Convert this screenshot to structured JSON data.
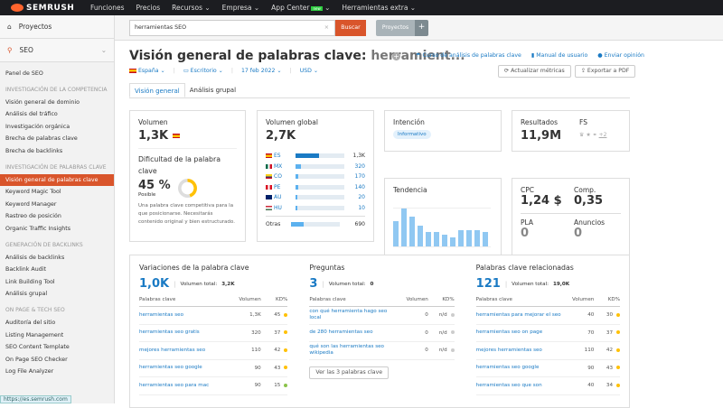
{
  "topbar": {
    "logo": "SEMRUSH",
    "nav": [
      "Funciones",
      "Precios",
      "Recursos",
      "Empresa",
      "App Center",
      "Herramientas extra"
    ],
    "new_badge": "new"
  },
  "sidebar": {
    "projects": "Proyectos",
    "seo": "SEO",
    "panel": "Panel de SEO",
    "sections": [
      {
        "heading": "INVESTIGACIÓN DE LA COMPETENCIA",
        "items": [
          "Visión general de dominio",
          "Análisis del tráfico",
          "Investigación orgánica",
          "Brecha de palabras clave",
          "Brecha de backlinks"
        ]
      },
      {
        "heading": "INVESTIGACIÓN DE PALABRAS CLAVE",
        "items": [
          "Visión general de palabras clave",
          "Keyword Magic Tool",
          "Keyword Manager",
          "Rastreo de posición",
          "Organic Traffic Insights"
        ]
      },
      {
        "heading": "GENERACIÓN DE BACKLINKS",
        "items": [
          "Análisis de backlinks",
          "Backlink Audit",
          "Link Building Tool",
          "Análisis grupal"
        ]
      },
      {
        "heading": "ON PAGE & TECH SEO",
        "items": [
          "Auditoría del sitio",
          "Listing Management",
          "SEO Content Template",
          "On Page SEO Checker",
          "Log File Analyzer"
        ]
      }
    ],
    "active": "Visión general de palabras clave",
    "status_url": "https://es.semrush.com"
  },
  "search": {
    "value": "herramientas SEO",
    "button": "Buscar",
    "projects": "Proyectos",
    "plus": "+"
  },
  "header": {
    "title": "Visión general de palabras clave:",
    "keyword": "herramient...",
    "links": [
      "Curso de análisis de palabras clave",
      "Manual de usuario",
      "Enviar opinión"
    ],
    "update": "Actualizar métricas",
    "export": "Exportar a PDF",
    "filters": [
      "España",
      "Escritorio",
      "17 feb 2022",
      "USD"
    ],
    "tabs": [
      "Visión general",
      "Análisis grupal"
    ]
  },
  "volume": {
    "label": "Volumen",
    "value": "1,3K",
    "kd_label": "Dificultad de la palabra clave",
    "kd": "45 %",
    "kd_percent": 45,
    "kd_level": "Posible",
    "kd_desc": "Una palabra clave competitiva para la que posicionarse. Necesitarás contenido original y bien estructurado."
  },
  "global": {
    "label": "Volumen global",
    "value": "2,7K",
    "rows": [
      {
        "code": "ES",
        "value": "1,3K",
        "share": 0.48
      },
      {
        "code": "MX",
        "value": "320",
        "share": 0.12
      },
      {
        "code": "CO",
        "value": "170",
        "share": 0.06
      },
      {
        "code": "PE",
        "value": "140",
        "share": 0.05
      },
      {
        "code": "AU",
        "value": "20",
        "share": 0.01
      },
      {
        "code": "HU",
        "value": "10",
        "share": 0.01
      }
    ],
    "others_label": "Otras",
    "others": "690",
    "others_share": 0.26
  },
  "intent": {
    "label": "Intención",
    "value": "Informativo"
  },
  "results": {
    "label": "Resultados",
    "value": "11,9M",
    "fs_label": "FS",
    "fs_more": "+2"
  },
  "trend": {
    "label": "Tendencia",
    "values": [
      0.66,
      1.0,
      0.79,
      0.54,
      0.37,
      0.37,
      0.3,
      0.25,
      0.42,
      0.42,
      0.42,
      0.37
    ]
  },
  "cpc": {
    "cpc_label": "CPC",
    "cpc": "1,24 $",
    "comp_label": "Comp.",
    "comp": "0,35",
    "pla_label": "PLA",
    "pla": "0",
    "ads_label": "Anuncios",
    "ads": "0"
  },
  "variations": {
    "title": "Variaciones de la palabra clave",
    "count": "1,0K",
    "total_label": "Volumen total:",
    "total": "3,2K",
    "cols": [
      "Palabras clave",
      "Volumen",
      "KD%"
    ],
    "rows": [
      [
        "herramientas seo",
        "1,3K",
        "45"
      ],
      [
        "herramientas seo gratis",
        "320",
        "37"
      ],
      [
        "mejores herramientas seo",
        "110",
        "42"
      ],
      [
        "herramientas seo google",
        "90",
        "43"
      ],
      [
        "herramientas seo para mac",
        "90",
        "15"
      ]
    ]
  },
  "questions": {
    "title": "Preguntas",
    "count": "3",
    "total_label": "Volumen total:",
    "total": "0",
    "cols": [
      "Palabras clave",
      "Volumen",
      "KD%"
    ],
    "rows": [
      [
        "con qué herramienta hago seo local",
        "0",
        "n/d"
      ],
      [
        "de 280 herramientas seo",
        "0",
        "n/d"
      ],
      [
        "qué son las herramientas seo wikipedia",
        "0",
        "n/d"
      ]
    ],
    "button": "Ver las 3 palabras clave"
  },
  "related": {
    "title": "Palabras clave relacionadas",
    "count": "121",
    "total_label": "Volumen total:",
    "total": "19,0K",
    "cols": [
      "Palabras clave",
      "Volumen",
      "KD%"
    ],
    "rows": [
      [
        "herramientas para mejorar el seo",
        "40",
        "30"
      ],
      [
        "herramientas seo on page",
        "70",
        "37"
      ],
      [
        "mejores herramientas seo",
        "110",
        "42"
      ],
      [
        "herramientas seo google",
        "90",
        "43"
      ],
      [
        "herramientas seo que son",
        "40",
        "34"
      ]
    ]
  },
  "colors": {
    "accent": "#d9552b",
    "link": "#1a7ac4",
    "kd_yellow": "#ffc107",
    "kd_green": "#8bc34a",
    "nd_gray": "#cccccc",
    "bar": "#5cb1ef",
    "trend": "#90c8f2"
  }
}
